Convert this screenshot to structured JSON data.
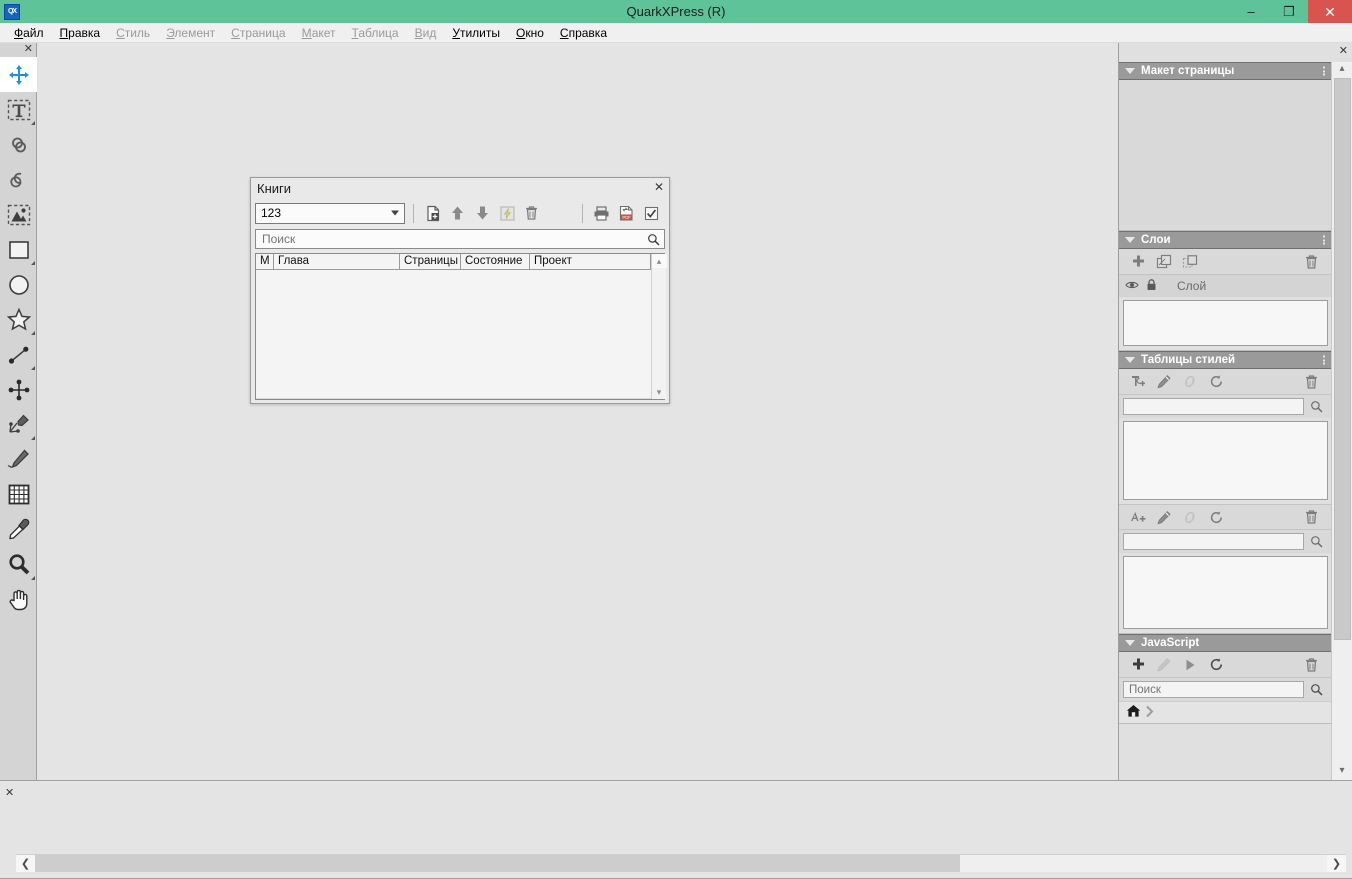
{
  "window": {
    "title": "QuarkXPress (R)",
    "app_icon": "quarkxpress-logo",
    "minimize": "–",
    "maximize": "❐",
    "close": "✕",
    "titlebar_color": "#5fc39a",
    "close_color": "#d9534f"
  },
  "menubar": {
    "items": [
      {
        "label": "Файл",
        "accel": "Ф",
        "enabled": true
      },
      {
        "label": "Правка",
        "accel": "П",
        "enabled": true
      },
      {
        "label": "Стиль",
        "accel": "С",
        "enabled": false
      },
      {
        "label": "Элемент",
        "accel": "Э",
        "enabled": false
      },
      {
        "label": "Страница",
        "accel": "С",
        "enabled": false
      },
      {
        "label": "Макет",
        "accel": "М",
        "enabled": false
      },
      {
        "label": "Таблица",
        "accel": "Т",
        "enabled": false
      },
      {
        "label": "Вид",
        "accel": "В",
        "enabled": false
      },
      {
        "label": "Утилиты",
        "accel": "У",
        "enabled": true
      },
      {
        "label": "Окно",
        "accel": "О",
        "enabled": true
      },
      {
        "label": "Справка",
        "accel": "С",
        "enabled": true
      }
    ]
  },
  "toolpalette": {
    "close": "✕",
    "tools": [
      {
        "name": "item-move-tool",
        "icon": "move-arrows-icon",
        "active": true,
        "submenu": false
      },
      {
        "name": "text-content-tool",
        "icon": "text-box-icon",
        "active": false,
        "submenu": true
      },
      {
        "name": "link-text-boxes-tool",
        "icon": "link-chain-icon",
        "active": false,
        "submenu": false
      },
      {
        "name": "unlink-text-boxes-tool",
        "icon": "unlink-chain-icon",
        "active": false,
        "submenu": false
      },
      {
        "name": "picture-content-tool",
        "icon": "picture-box-icon",
        "active": false,
        "submenu": false
      },
      {
        "name": "rectangle-box-tool",
        "icon": "rectangle-icon",
        "active": false,
        "submenu": true
      },
      {
        "name": "oval-box-tool",
        "icon": "ellipse-icon",
        "active": false,
        "submenu": false
      },
      {
        "name": "starburst-tool",
        "icon": "star-icon",
        "active": false,
        "submenu": true
      },
      {
        "name": "line-tool",
        "icon": "line-endpoints-icon",
        "active": false,
        "submenu": true
      },
      {
        "name": "composition-zones-tool",
        "icon": "four-nodes-icon",
        "active": false,
        "submenu": false
      },
      {
        "name": "bezier-pen-tool",
        "icon": "pen-nib-icon",
        "active": false,
        "submenu": true
      },
      {
        "name": "freehand-drawing-tool",
        "icon": "pencil-icon",
        "active": false,
        "submenu": false
      },
      {
        "name": "table-tool",
        "icon": "table-grid-icon",
        "active": false,
        "submenu": false
      },
      {
        "name": "eyedropper-tool",
        "icon": "eyedropper-icon",
        "active": false,
        "submenu": false
      },
      {
        "name": "zoom-tool",
        "icon": "magnifier-icon",
        "active": false,
        "submenu": true
      },
      {
        "name": "pan-tool",
        "icon": "hand-icon",
        "active": false,
        "submenu": false
      }
    ]
  },
  "books_dialog": {
    "title": "Книги",
    "close": "✕",
    "book_selector": {
      "value": "123",
      "arrow": "▾"
    },
    "toolbar": [
      {
        "name": "add-chapter-button",
        "icon": "add-document-icon",
        "enabled": true
      },
      {
        "name": "move-chapter-up-button",
        "icon": "arrow-up-icon",
        "enabled": true
      },
      {
        "name": "move-chapter-down-button",
        "icon": "arrow-down-icon",
        "enabled": true
      },
      {
        "name": "synchronize-book-button",
        "icon": "sync-lightning-icon",
        "enabled": false
      },
      {
        "name": "remove-chapter-button",
        "icon": "trash-icon",
        "enabled": true
      },
      {
        "name": "print-book-button",
        "icon": "printer-icon",
        "enabled": true
      },
      {
        "name": "export-pdf-button",
        "icon": "pdf-export-icon",
        "enabled": true
      },
      {
        "name": "job-jackets-button",
        "icon": "checkmark-box-icon",
        "enabled": true
      }
    ],
    "search": {
      "placeholder": "Поиск",
      "value": "",
      "icon": "search-icon"
    },
    "columns": [
      {
        "label": "М",
        "width": 18
      },
      {
        "label": "Глава",
        "width": 126
      },
      {
        "label": "Страницы",
        "width": 61
      },
      {
        "label": "Состояние",
        "width": 69
      },
      {
        "label": "Проект",
        "width": 121
      }
    ],
    "rows": [],
    "scroll": {
      "up": "▴",
      "down": "▾"
    }
  },
  "dock": {
    "close": "✕",
    "scroll": {
      "up": "▴",
      "down": "▾"
    },
    "panels": [
      {
        "name": "page-layout",
        "title": "Макет страницы",
        "collapse_icon": "triangle-down-icon",
        "menu_icon": "kebab-menu-icon",
        "body": "blank"
      },
      {
        "name": "layers",
        "title": "Слои",
        "collapse_icon": "triangle-down-icon",
        "menu_icon": "kebab-menu-icon",
        "toolbar": [
          {
            "name": "new-layer-button",
            "icon": "plus-icon",
            "enabled": true
          },
          {
            "name": "duplicate-layer-button",
            "icon": "duplicate-layers-icon",
            "enabled": true
          },
          {
            "name": "merge-layers-button",
            "icon": "merge-layers-icon",
            "enabled": true
          },
          {
            "name": "delete-layer-button",
            "icon": "trash-icon",
            "enabled": true
          }
        ],
        "row_header": {
          "visibility_icon": "eye-icon",
          "lock_icon": "lock-icon",
          "label": "Слой"
        }
      },
      {
        "name": "style-sheets",
        "title": "Таблицы стилей",
        "collapse_icon": "triangle-down-icon",
        "menu_icon": "kebab-menu-icon",
        "paragraph_toolbar": [
          {
            "name": "new-paragraph-style-button",
            "icon": "new-paragraph-style-icon",
            "enabled": true
          },
          {
            "name": "edit-paragraph-style-button",
            "icon": "pencil-icon",
            "enabled": true
          },
          {
            "name": "duplicate-paragraph-style-button",
            "icon": "link-icon",
            "enabled": false
          },
          {
            "name": "update-paragraph-style-button",
            "icon": "refresh-icon",
            "enabled": true
          },
          {
            "name": "delete-paragraph-style-button",
            "icon": "trash-icon",
            "enabled": true
          }
        ],
        "paragraph_search": {
          "placeholder": "",
          "value": "",
          "icon": "search-icon"
        },
        "character_toolbar": [
          {
            "name": "new-character-style-button",
            "icon": "new-character-style-icon",
            "enabled": true
          },
          {
            "name": "edit-character-style-button",
            "icon": "pencil-icon",
            "enabled": true
          },
          {
            "name": "duplicate-character-style-button",
            "icon": "link-icon",
            "enabled": false
          },
          {
            "name": "update-character-style-button",
            "icon": "refresh-icon",
            "enabled": true
          },
          {
            "name": "delete-character-style-button",
            "icon": "trash-icon",
            "enabled": true
          }
        ],
        "character_search": {
          "placeholder": "",
          "value": "",
          "icon": "search-icon"
        }
      },
      {
        "name": "javascript",
        "title": "JavaScript",
        "collapse_icon": "triangle-down-icon",
        "toolbar": [
          {
            "name": "new-script-button",
            "icon": "plus-icon",
            "enabled": true
          },
          {
            "name": "edit-script-button",
            "icon": "pencil-icon",
            "enabled": false
          },
          {
            "name": "run-script-button",
            "icon": "play-icon",
            "enabled": true
          },
          {
            "name": "reload-scripts-button",
            "icon": "refresh-icon",
            "enabled": true
          },
          {
            "name": "delete-script-button",
            "icon": "trash-icon",
            "enabled": true
          }
        ],
        "search": {
          "placeholder": "Поиск",
          "value": "",
          "icon": "search-icon"
        },
        "breadcrumb": {
          "home_icon": "home-icon",
          "separator_icon": "chevron-right-icon"
        }
      }
    ]
  },
  "bottom": {
    "close": "✕",
    "hscroll": {
      "left": "❮",
      "right": "❯"
    }
  }
}
